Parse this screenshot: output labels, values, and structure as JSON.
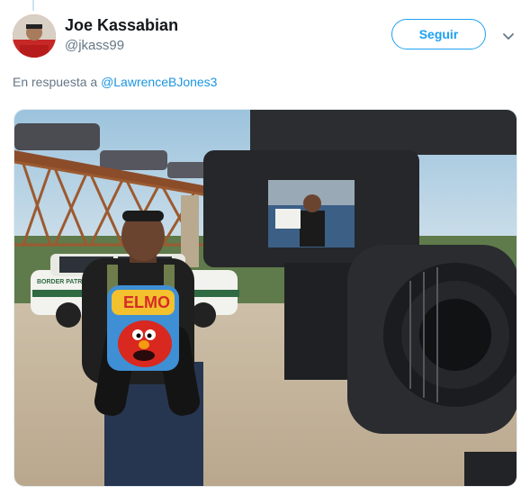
{
  "tweet": {
    "author_name": "Joe Kassabian",
    "author_handle": "@jkass99",
    "follow_label": "Seguir",
    "reply_prefix": "En respuesta a",
    "reply_mention": "@LawrenceBJones3"
  },
  "photo": {
    "vehicle_text": "BORDER PATROL",
    "backpack_text": "ELMO"
  },
  "colors": {
    "accent": "#1da1f2",
    "link": "#1b95e0",
    "secondary_text": "#657786"
  },
  "icons": [
    "chevron-down-icon"
  ]
}
